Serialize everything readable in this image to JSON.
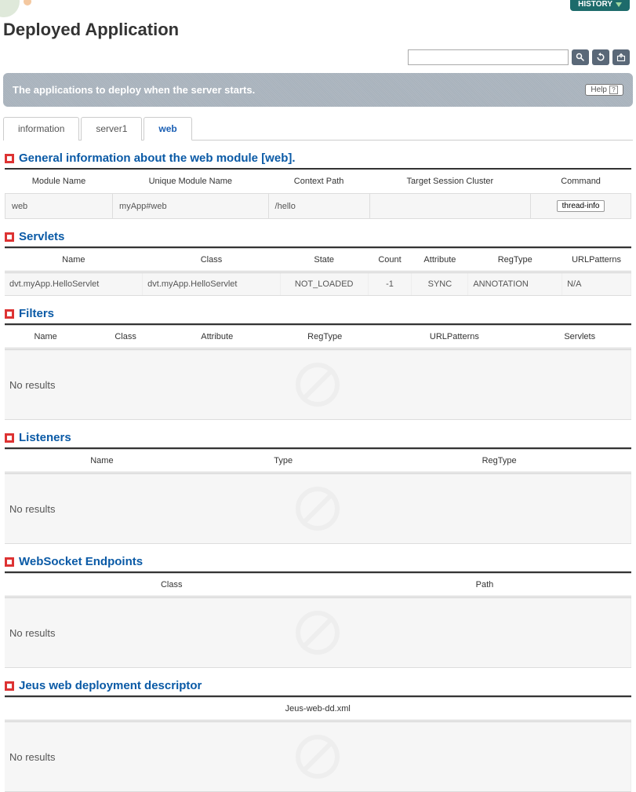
{
  "header": {
    "history": "HISTORY",
    "title": "Deployed Application",
    "search_placeholder": "",
    "help": "Help"
  },
  "banner": {
    "text": "The applications to deploy when the server starts."
  },
  "tabs": [
    {
      "label": "information",
      "active": false
    },
    {
      "label": "server1",
      "active": false
    },
    {
      "label": "web",
      "active": true
    }
  ],
  "general_info": {
    "title": "General information about the web module [web].",
    "headers": {
      "module_name": "Module Name",
      "unique_module_name": "Unique Module Name",
      "context_path": "Context Path",
      "target_session_cluster": "Target Session Cluster",
      "command": "Command"
    },
    "row": {
      "module_name": "web",
      "unique_module_name": "myApp#web",
      "context_path": "/hello",
      "target_session_cluster": "",
      "command": "thread-info"
    }
  },
  "servlets": {
    "title": "Servlets",
    "headers": {
      "name": "Name",
      "class": "Class",
      "state": "State",
      "count": "Count",
      "attribute": "Attribute",
      "regtype": "RegType",
      "urlpatterns": "URLPatterns"
    },
    "rows": [
      {
        "name": "dvt.myApp.HelloServlet",
        "class": "dvt.myApp.HelloServlet",
        "state": "NOT_LOADED",
        "count": "-1",
        "attribute": "SYNC",
        "regtype": "ANNOTATION",
        "urlpatterns": "N/A"
      }
    ]
  },
  "filters": {
    "title": "Filters",
    "headers": {
      "name": "Name",
      "class": "Class",
      "attribute": "Attribute",
      "regtype": "RegType",
      "urlpatterns": "URLPatterns",
      "servlets": "Servlets"
    },
    "empty": "No results"
  },
  "listeners": {
    "title": "Listeners",
    "headers": {
      "name": "Name",
      "type": "Type",
      "regtype": "RegType"
    },
    "empty": "No results"
  },
  "websocket": {
    "title": "WebSocket Endpoints",
    "headers": {
      "class": "Class",
      "path": "Path"
    },
    "empty": "No results"
  },
  "descriptor": {
    "title": "Jeus web deployment descriptor",
    "headers": {
      "file": "Jeus-web-dd.xml"
    },
    "empty": "No results"
  }
}
